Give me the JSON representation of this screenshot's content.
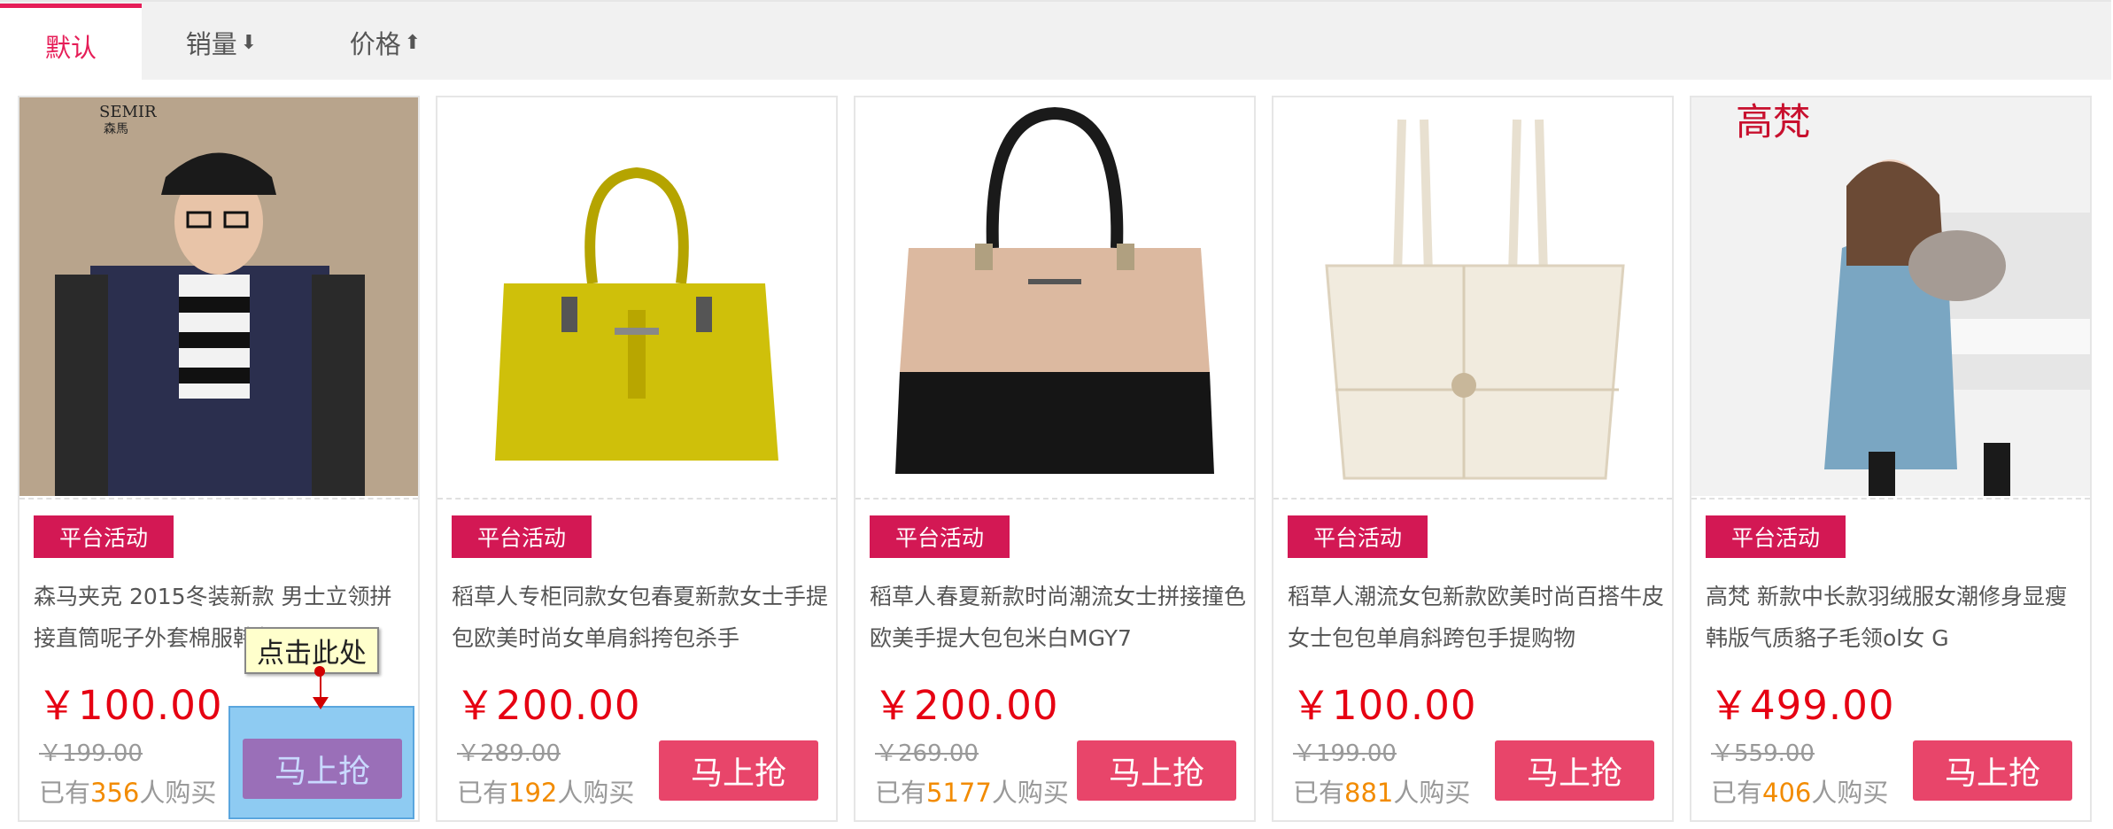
{
  "sort_tabs": [
    {
      "label": "默认",
      "arrow": ""
    },
    {
      "label": "销量",
      "arrow": "⬇"
    },
    {
      "label": "价格",
      "arrow": "⬆"
    }
  ],
  "products": [
    {
      "brand_logo": "SEMIR 森馬",
      "badge": "平台活动",
      "title": "森马夹克 2015冬装新款 男士立领拼接直筒呢子外套棉服韩版",
      "price": "￥100.00",
      "original_price": "￥199.00",
      "sold_prefix": "已有",
      "sold_count": "356",
      "sold_suffix": "人购买",
      "buy_label": "马上抢"
    },
    {
      "brand_logo": "",
      "badge": "平台活动",
      "title": "稻草人专柜同款女包春夏新款女士手提包欧美时尚女单肩斜挎包杀手",
      "price": "￥200.00",
      "original_price": "￥289.00",
      "sold_prefix": "已有",
      "sold_count": "192",
      "sold_suffix": "人购买",
      "buy_label": "马上抢"
    },
    {
      "brand_logo": "",
      "badge": "平台活动",
      "title": "稻草人春夏新款时尚潮流女士拼接撞色欧美手提大包包米白MGY7",
      "price": "￥200.00",
      "original_price": "￥269.00",
      "sold_prefix": "已有",
      "sold_count": "5177",
      "sold_suffix": "人购买",
      "buy_label": "马上抢"
    },
    {
      "brand_logo": "",
      "badge": "平台活动",
      "title": "稻草人潮流女包新款欧美时尚百搭牛皮女士包包单肩斜跨包手提购物",
      "price": "￥100.00",
      "original_price": "￥199.00",
      "sold_prefix": "已有",
      "sold_count": "881",
      "sold_suffix": "人购买",
      "buy_label": "马上抢"
    },
    {
      "brand_logo": "高梵",
      "badge": "平台活动",
      "title": "高梵 新款中长款羽绒服女潮修身显瘦韩版气质貉子毛领ol女 G",
      "price": "￥499.00",
      "original_price": "￥559.00",
      "sold_prefix": "已有",
      "sold_count": "406",
      "sold_suffix": "人购买",
      "buy_label": "马上抢"
    }
  ],
  "tooltip": "点击此处",
  "colors": {
    "accent": "#e61e58",
    "badge": "#d31854",
    "price": "#e60012",
    "buy": "#e8456a",
    "sold_count": "#f28b00"
  }
}
